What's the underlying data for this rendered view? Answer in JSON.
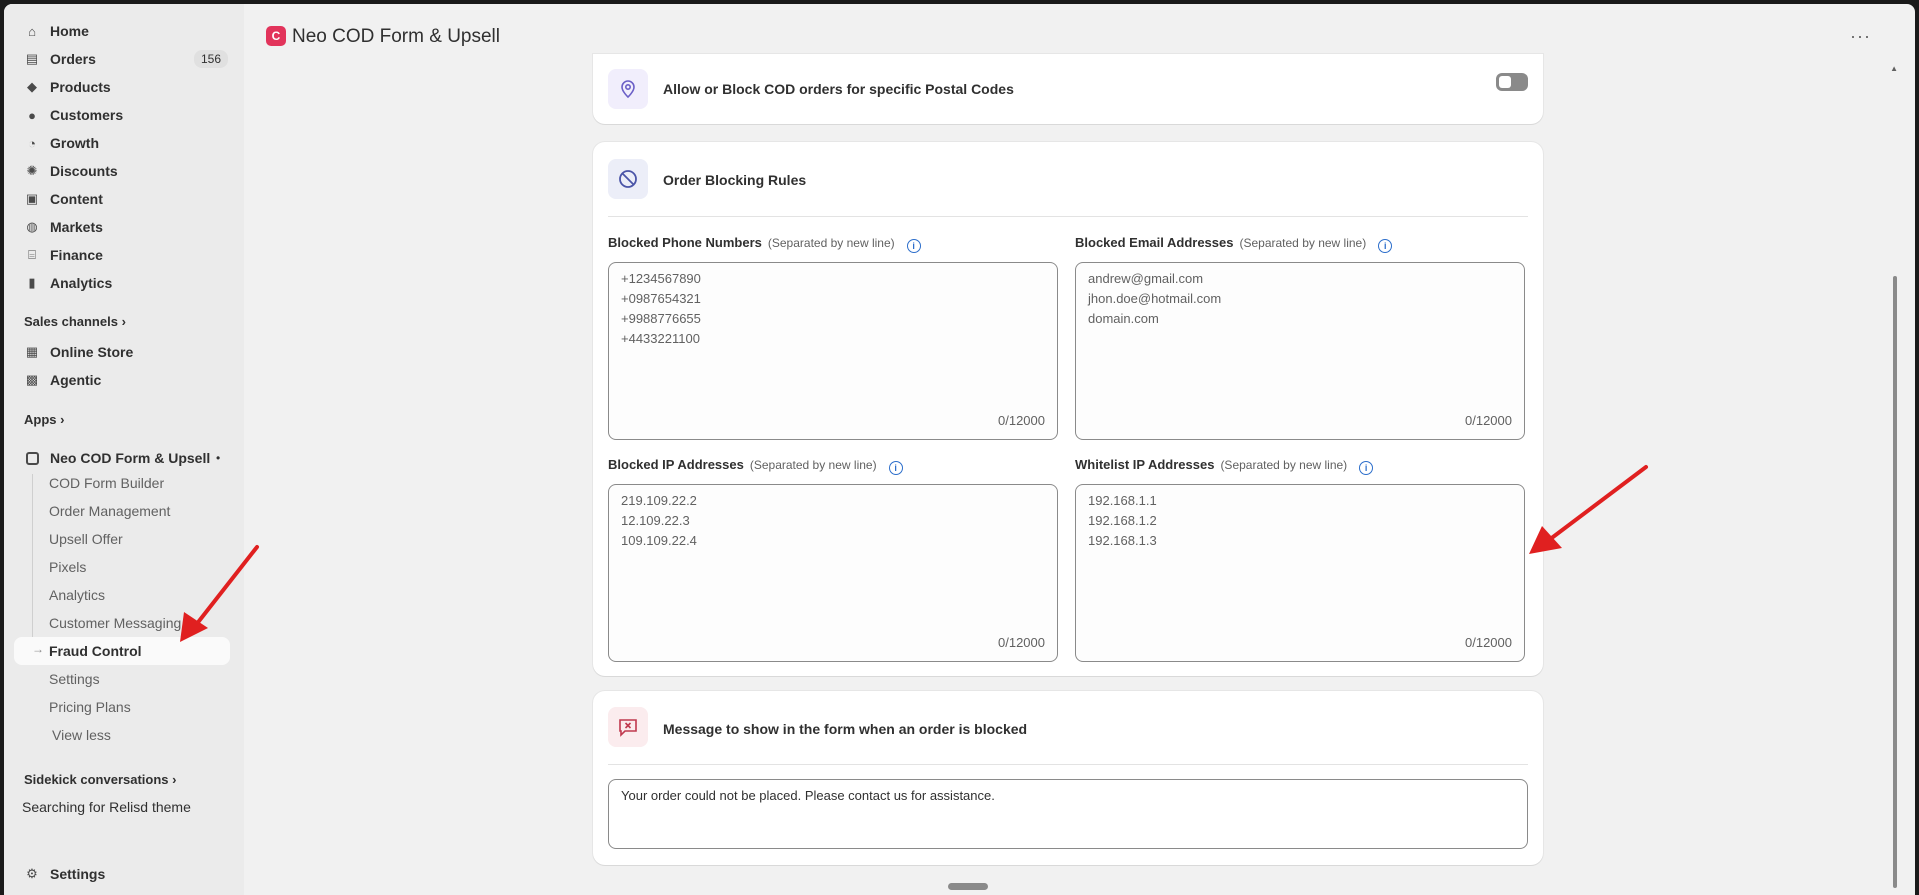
{
  "nav": {
    "items": [
      {
        "label": "Home",
        "icon": "home-icon",
        "glyph": "⌂"
      },
      {
        "label": "Orders",
        "icon": "orders-icon",
        "glyph": "▤",
        "badge": "156"
      },
      {
        "label": "Products",
        "icon": "tag-icon",
        "glyph": "◆"
      },
      {
        "label": "Customers",
        "icon": "person-icon",
        "glyph": "●"
      },
      {
        "label": "Growth",
        "icon": "growth-icon",
        "glyph": "◔"
      },
      {
        "label": "Discounts",
        "icon": "discount-icon",
        "glyph": "✺"
      },
      {
        "label": "Content",
        "icon": "content-icon",
        "glyph": "▣"
      },
      {
        "label": "Markets",
        "icon": "globe-icon",
        "glyph": "◍"
      },
      {
        "label": "Finance",
        "icon": "bank-icon",
        "glyph": "⌸"
      },
      {
        "label": "Analytics",
        "icon": "bar-chart-icon",
        "glyph": "▮"
      }
    ],
    "sales_channels_label": "Sales channels",
    "channels": [
      {
        "label": "Online Store",
        "icon": "store-icon",
        "glyph": "▦"
      },
      {
        "label": "Agentic",
        "icon": "agentic-icon",
        "glyph": "▩"
      }
    ],
    "apps_label": "Apps",
    "app_name": "Neo COD Form & Upsell",
    "app_dot": "•",
    "app_sub": [
      "COD Form Builder",
      "Order Management",
      "Upsell Offer",
      "Pixels",
      "Analytics",
      "Customer Messaging",
      "Fraud Control",
      "Settings",
      "Pricing Plans"
    ],
    "view_less": "View less",
    "sidekick_label": "Sidekick conversations",
    "sidekick_item": "Searching for Relisd theme",
    "settings": "Settings"
  },
  "topbar": {
    "logo_text": "C",
    "title": "Neo COD Form & Upsell",
    "more": "···"
  },
  "postal_card": {
    "title": "Allow or Block COD orders for specific Postal Codes",
    "toggle_on": false
  },
  "blocking_card": {
    "title": "Order Blocking Rules",
    "fields": [
      {
        "label": "Blocked Phone Numbers",
        "hint": "(Separated by new line)",
        "values": [
          "+1234567890",
          "+0987654321",
          "+9988776655",
          "+4433221100"
        ],
        "counter": "0/12000"
      },
      {
        "label": "Blocked Email Addresses",
        "hint": "(Separated by new line)",
        "values": [
          "andrew@gmail.com",
          "jhon.doe@hotmail.com",
          "domain.com"
        ],
        "counter": "0/12000"
      },
      {
        "label": "Blocked IP Addresses",
        "hint": "(Separated by new line)",
        "values": [
          "219.109.22.2",
          "12.109.22.3",
          "109.109.22.4"
        ],
        "counter": "0/12000"
      },
      {
        "label": "Whitelist IP Addresses",
        "hint": "(Separated by new line)",
        "values": [
          "192.168.1.1",
          "192.168.1.2",
          "192.168.1.3"
        ],
        "counter": "0/12000"
      }
    ]
  },
  "message_card": {
    "title": "Message to show in the form when an order is blocked",
    "value": "Your order could not be placed. Please contact us for assistance."
  },
  "colors": {
    "accent_red": "#e02020",
    "app_brand": "#e2345b",
    "info_blue": "#2c6ecb"
  }
}
